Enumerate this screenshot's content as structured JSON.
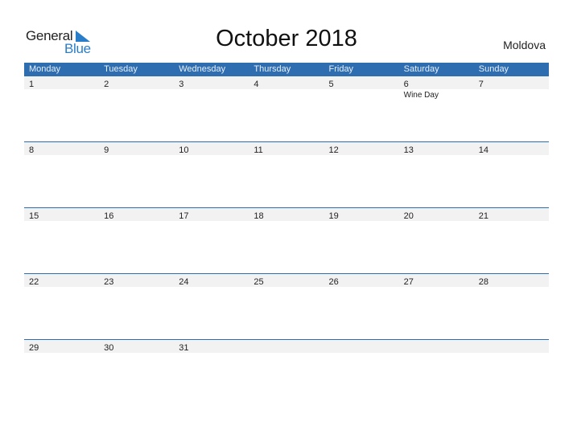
{
  "logo": {
    "general": "General",
    "blue": "Blue",
    "icon": "triangle-flag-icon",
    "accent": "#2a7dc9"
  },
  "title": "October 2018",
  "country": "Moldova",
  "colors": {
    "header_bg": "#2e6db0",
    "date_strip": "#f2f2f2"
  },
  "weekdays": [
    "Monday",
    "Tuesday",
    "Wednesday",
    "Thursday",
    "Friday",
    "Saturday",
    "Sunday"
  ],
  "weeks": [
    {
      "days": [
        {
          "date": "1",
          "event": ""
        },
        {
          "date": "2",
          "event": ""
        },
        {
          "date": "3",
          "event": ""
        },
        {
          "date": "4",
          "event": ""
        },
        {
          "date": "5",
          "event": ""
        },
        {
          "date": "6",
          "event": "Wine Day"
        },
        {
          "date": "7",
          "event": ""
        }
      ]
    },
    {
      "days": [
        {
          "date": "8",
          "event": ""
        },
        {
          "date": "9",
          "event": ""
        },
        {
          "date": "10",
          "event": ""
        },
        {
          "date": "11",
          "event": ""
        },
        {
          "date": "12",
          "event": ""
        },
        {
          "date": "13",
          "event": ""
        },
        {
          "date": "14",
          "event": ""
        }
      ]
    },
    {
      "days": [
        {
          "date": "15",
          "event": ""
        },
        {
          "date": "16",
          "event": ""
        },
        {
          "date": "17",
          "event": ""
        },
        {
          "date": "18",
          "event": ""
        },
        {
          "date": "19",
          "event": ""
        },
        {
          "date": "20",
          "event": ""
        },
        {
          "date": "21",
          "event": ""
        }
      ]
    },
    {
      "days": [
        {
          "date": "22",
          "event": ""
        },
        {
          "date": "23",
          "event": ""
        },
        {
          "date": "24",
          "event": ""
        },
        {
          "date": "25",
          "event": ""
        },
        {
          "date": "26",
          "event": ""
        },
        {
          "date": "27",
          "event": ""
        },
        {
          "date": "28",
          "event": ""
        }
      ]
    },
    {
      "days": [
        {
          "date": "29",
          "event": ""
        },
        {
          "date": "30",
          "event": ""
        },
        {
          "date": "31",
          "event": ""
        },
        {
          "date": "",
          "event": ""
        },
        {
          "date": "",
          "event": ""
        },
        {
          "date": "",
          "event": ""
        },
        {
          "date": "",
          "event": ""
        }
      ]
    }
  ]
}
